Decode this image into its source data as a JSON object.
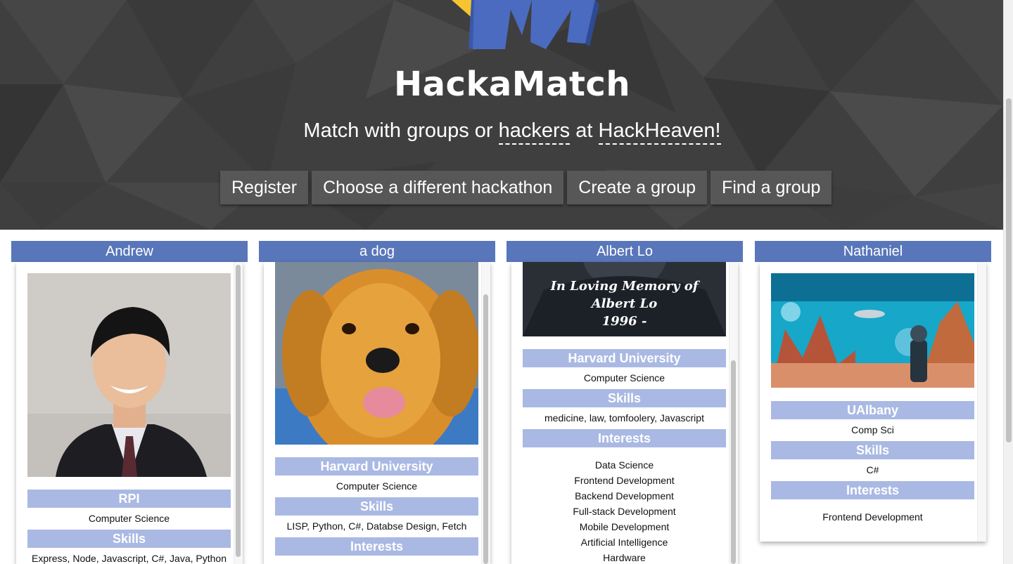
{
  "hero": {
    "title": "HackaMatch",
    "subtitle_prefix": "Match with groups or",
    "subtitle_role": "hackers",
    "subtitle_mid": "at",
    "subtitle_hackathon": "HackHeaven!",
    "background_color": "#3f3f3f",
    "logo_colors": {
      "blue": "#4a6bbf",
      "yellow": "#f5c431"
    }
  },
  "nav": {
    "register": "Register",
    "choose_hackathon": "Choose a different hackathon",
    "create_group": "Create a group",
    "find_group": "Find a group"
  },
  "colors": {
    "card_header": "#5876b9",
    "section_header": "#aab9e3"
  },
  "labels": {
    "skills": "Skills",
    "interests": "Interests"
  },
  "cards": [
    {
      "name": "Andrew",
      "photo": "portrait-photo",
      "school": "RPI",
      "major": "Computer Science",
      "skills": "Express, Node, Javascript, C#, Java, Python",
      "interests": []
    },
    {
      "name": "a dog",
      "photo": "golden-retriever-photo",
      "school": "Harvard University",
      "major": "Computer Science",
      "skills": "LISP, Python, C#, Databse Design, Fetch",
      "interests": []
    },
    {
      "name": "Albert Lo",
      "photo": "memorial-banner-photo",
      "photo_caption": [
        "In Loving Memory of",
        "Albert Lo",
        "1996 -"
      ],
      "school": "Harvard University",
      "major": "Computer Science",
      "skills": "medicine, law, tomfoolery, Javascript",
      "interests": [
        "Data Science",
        "Frontend Development",
        "Backend Development",
        "Full-stack Development",
        "Mobile Development",
        "Artificial Intelligence",
        "Hardware"
      ]
    },
    {
      "name": "Nathaniel",
      "photo": "scifi-landscape-photo",
      "school": "UAlbany",
      "major": "Comp Sci",
      "skills": "C#",
      "interests": [
        "Frontend Development"
      ]
    }
  ]
}
